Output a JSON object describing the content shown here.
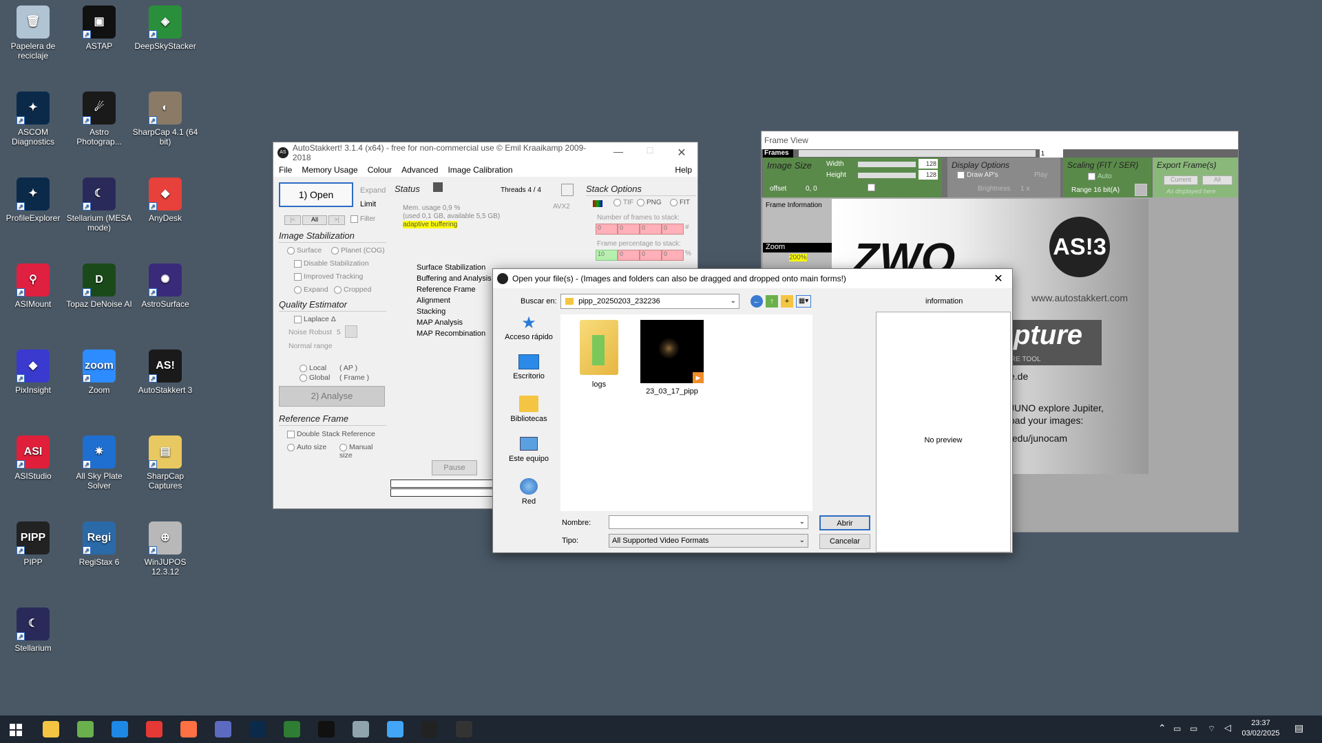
{
  "desktop": {
    "icons": [
      {
        "label": "Papelera de reciclaje",
        "color": "#b0c4d4",
        "glyph": "🗑"
      },
      {
        "label": "ASTAP",
        "color": "#111111",
        "glyph": "▣"
      },
      {
        "label": "DeepSkyStacker",
        "color": "#2a8f3a",
        "glyph": "◈"
      },
      {
        "label": "ASCOM Diagnostics",
        "color": "#0b2a4a",
        "glyph": "✦"
      },
      {
        "label": "Astro Photograp...",
        "color": "#1a1a1a",
        "glyph": "☄"
      },
      {
        "label": "SharpCap 4.1 (64 bit)",
        "color": "#8a7a66",
        "glyph": "◐"
      },
      {
        "label": "ProfileExplorer",
        "color": "#0b2a4a",
        "glyph": "✦"
      },
      {
        "label": "Stellarium (MESA mode)",
        "color": "#2a2a5a",
        "glyph": "☾"
      },
      {
        "label": "AnyDesk",
        "color": "#e8403b",
        "glyph": "◆"
      },
      {
        "label": "ASIMount",
        "color": "#e02040",
        "glyph": "⚲"
      },
      {
        "label": "Topaz DeNoise AI",
        "color": "#1a4a1a",
        "glyph": "D"
      },
      {
        "label": "AstroSurface",
        "color": "#3a2a7a",
        "glyph": "✺"
      },
      {
        "label": "PixInsight",
        "color": "#3a3acf",
        "glyph": "◆"
      },
      {
        "label": "Zoom",
        "color": "#2d8cff",
        "glyph": "zoom"
      },
      {
        "label": "AutoStakkert 3",
        "color": "#1a1a1a",
        "glyph": "AS!"
      },
      {
        "label": "ASIStudio",
        "color": "#e0203a",
        "glyph": "ASI"
      },
      {
        "label": "All Sky Plate Solver",
        "color": "#1e6fd0",
        "glyph": "✷"
      },
      {
        "label": "SharpCap Captures",
        "color": "#e8c860",
        "glyph": "▤"
      },
      {
        "label": "PIPP",
        "color": "#222222",
        "glyph": "PIPP"
      },
      {
        "label": "RegiStax 6",
        "color": "#2a6aa8",
        "glyph": "Regi"
      },
      {
        "label": "WinJUPOS 12.3.12",
        "color": "#b8b8b8",
        "glyph": "⊕"
      },
      {
        "label": "Stellarium",
        "color": "#2a2a5a",
        "glyph": "☾"
      }
    ]
  },
  "autostakkert": {
    "title": "AutoStakkert! 3.1.4 (x64) - free for non-commercial use © Emil Kraaikamp 2009-2018",
    "menu": [
      "File",
      "Memory Usage",
      "Colour",
      "Advanced",
      "Image Calibration"
    ],
    "help": "Help",
    "open_button": "1) Open",
    "expand": "Expand",
    "limit": "Limit",
    "nav": [
      "|<",
      "All",
      ">|"
    ],
    "filter": "Filter",
    "image_stabilization": "Image Stabilization",
    "surface": "Surface",
    "planet": "Planet (COG)",
    "disable_stab": "Disable Stabilization",
    "improved_tracking": "Improved Tracking",
    "expand2": "Expand",
    "cropped": "Cropped",
    "quality_estimator": "Quality Estimator",
    "laplace": "Laplace Δ",
    "noise_robust": "Noise Robust",
    "noise_value": "5",
    "normal_range": "Normal range",
    "local": "Local",
    "local_ap": "( AP )",
    "global": "Global",
    "global_frame": "( Frame )",
    "analyse_button": "2) Analyse",
    "reference_frame": "Reference Frame",
    "double_stack": "Double Stack Reference",
    "auto_size": "Auto size",
    "manual_size": "Manual size",
    "status": "Status",
    "threads": "Threads 4 / 4",
    "avx": "AVX2",
    "mem_usage": "Mem. usage 0,9 %",
    "mem_detail": "(used 0,1 GB, available 5,5 GB)",
    "adaptive": "adaptive buffering",
    "steps": [
      "Surface Stabilization",
      "Buffering and Analysis",
      "Reference Frame",
      "Alignment",
      "Stacking",
      "MAP Analysis",
      "MAP Recombination"
    ],
    "pause": "Pause",
    "progress1": "0%",
    "progress2": "0%",
    "stack_options": "Stack Options",
    "tif": "TIF",
    "png": "PNG",
    "fit": "FIT",
    "num_frames": "Number of frames to stack:",
    "num_frames_vals": [
      "0",
      "0",
      "0",
      "0"
    ],
    "hash": "#",
    "frame_pct": "Frame percentage to stack:",
    "frame_pct_vals": [
      "10",
      "0",
      "0",
      "0"
    ],
    "pct": "%"
  },
  "frameview": {
    "title": "Frame View",
    "frames_label": "Frames",
    "frame_value": "1",
    "image_size": "Image Size",
    "width_label": "Width",
    "height_label": "Height",
    "width_val": "128",
    "height_val": "128",
    "offset_label": "offset",
    "offset_val": "0, 0",
    "display_options": "Display Options",
    "draw_aps": "Draw AP's",
    "brightness": "Brightness",
    "brightness_val": "1 x",
    "play": "Play",
    "scaling": "Scaling (FIT / SER)",
    "auto": "Auto",
    "range": "Range 16 bit(A)",
    "export_frames": "Export Frame(s)",
    "current": "Current",
    "all": "All",
    "as_displayed": "As displayed here",
    "frame_information": "Frame Information",
    "zoom": "Zoom",
    "zoom_val": "200%",
    "logo_zwo": "ZWO",
    "logo_as3": "AS!3",
    "site": "www.autostakkert.com",
    "capture_text": "pture",
    "capture_sub": "RE TOOL",
    "de": "e.de",
    "juno1": "JUNO explore Jupiter,",
    "juno2": "oad your images:",
    "juno3": ".edu/junocam"
  },
  "dialog": {
    "title": "Open your file(s)  -  (Images and folders can also be dragged and dropped onto main forms!)",
    "lookin_label": "Buscar en:",
    "lookin_value": "pipp_20250203_232236",
    "places": [
      "Acceso rápido",
      "Escritorio",
      "Bibliotecas",
      "Este equipo",
      "Red"
    ],
    "files": [
      {
        "name": "logs"
      },
      {
        "name": "23_03_17_pipp"
      }
    ],
    "info_label": "information",
    "no_preview": "No preview",
    "name_label": "Nombre:",
    "name_value": "",
    "type_label": "Tipo:",
    "type_value": "All Supported Video Formats",
    "open_button": "Abrir",
    "cancel_button": "Cancelar"
  },
  "taskbar": {
    "time": "23:37",
    "date": "03/02/2025",
    "apps": [
      {
        "name": "file-explorer-icon",
        "color": "#f4c542"
      },
      {
        "name": "notepad-icon",
        "color": "#6ab04c"
      },
      {
        "name": "vscode-icon",
        "color": "#1e88e5"
      },
      {
        "name": "chrome-icon",
        "color": "#e53935"
      },
      {
        "name": "firefox-icon",
        "color": "#ff7043"
      },
      {
        "name": "network-tool-icon",
        "color": "#5c6bc0"
      },
      {
        "name": "lightroom-icon",
        "color": "#0b2a4a"
      },
      {
        "name": "green-app-icon",
        "color": "#2e7d32"
      },
      {
        "name": "astro-photo-icon",
        "color": "#111111"
      },
      {
        "name": "sharpcap-icon",
        "color": "#90a4ae"
      },
      {
        "name": "photos-icon",
        "color": "#42a5f5"
      },
      {
        "name": "pipp-icon",
        "color": "#222222"
      },
      {
        "name": "autostakkert-icon",
        "color": "#333333"
      }
    ]
  }
}
